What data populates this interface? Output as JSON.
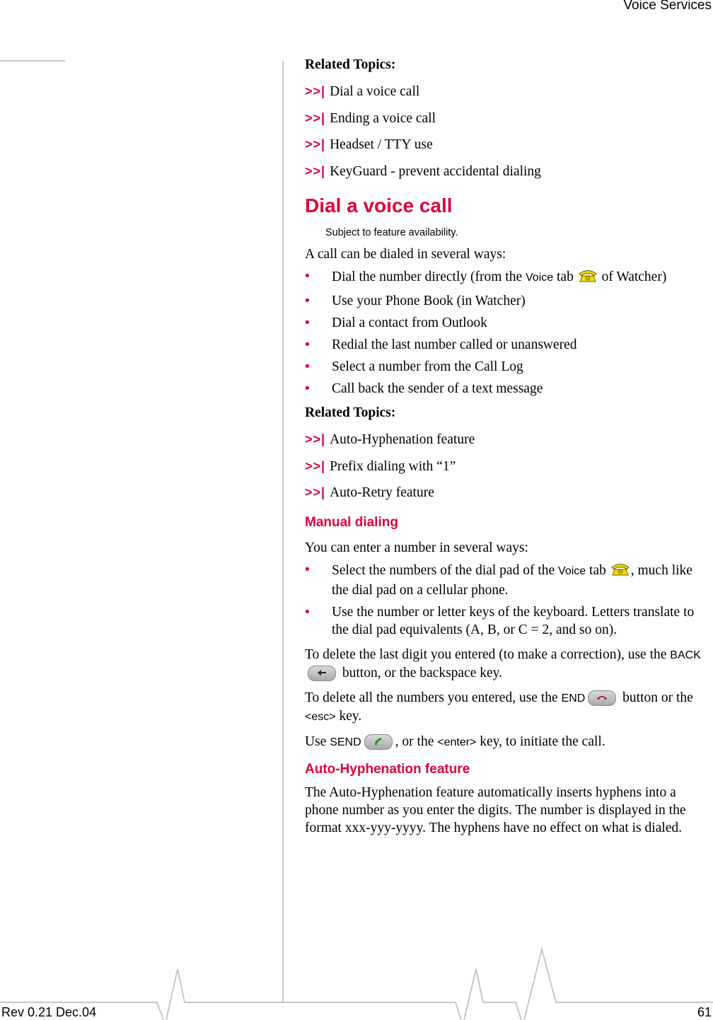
{
  "header": {
    "title": "Voice Services"
  },
  "colors": {
    "accent": "#e0003c",
    "rule": "#c8c8c8"
  },
  "related_topics_1": {
    "heading": "Related Topics:",
    "arrow": ">>|",
    "links": [
      "Dial a voice call",
      "Ending a voice call",
      "Headset / TTY use",
      "KeyGuard - prevent accidental dialing"
    ]
  },
  "dial_section": {
    "title": "Dial a voice call",
    "note": "Subject to feature availability.",
    "intro": "A call can be dialed in several ways:",
    "bullets": {
      "b1_pre": "Dial the number directly (from the ",
      "b1_ui": "Voice",
      "b1_mid": " tab ",
      "b1_icon": "phone-icon",
      "b1_post": " of Watcher)",
      "b2": "Use your Phone Book (in Watcher)",
      "b3": "Dial a contact from Outlook",
      "b4": "Redial the last number called or unanswered",
      "b5": "Select a number from the Call Log",
      "b6": "Call back the sender of a text message"
    }
  },
  "related_topics_2": {
    "heading": "Related Topics:",
    "arrow": ">>|",
    "links": [
      "Auto-Hyphenation feature",
      "Prefix dialing with “1”",
      "Auto-Retry feature"
    ]
  },
  "manual_section": {
    "title": "Manual dialing",
    "intro": "You can enter a number in several ways:",
    "bullet1_pre": "Select the numbers of the dial pad of the ",
    "bullet1_ui": "Voice",
    "bullet1_mid": " tab ",
    "bullet1_post": ", much like the dial pad on a cellular phone.",
    "bullet2": "Use the number or letter keys of the keyboard. Letters translate to the dial pad equivalents (A, B, or C = 2, and so on).",
    "back_pre": "To delete the last digit you entered (to make a correction), use the ",
    "back_ui": "BACK",
    "back_post": " button, or the backspace key.",
    "end_pre": "To delete all the numbers you entered, use the ",
    "end_ui": "END",
    "end_mid": " button or the ",
    "end_key": "<esc>",
    "end_post": " key.",
    "send_pre": "Use ",
    "send_ui": "SEND",
    "send_mid": ", or the ",
    "send_key": "<enter>",
    "send_post": " key, to initiate the call."
  },
  "hyphen_section": {
    "title": "Auto-Hyphenation feature",
    "body": "The Auto-Hyphenation feature automatically inserts hyphens into a phone number as you enter the digits. The number is displayed in the format xxx-yyy-yyyy. The hyphens have no effect on what is dialed."
  },
  "footer": {
    "revision": "Rev 0.21  Dec.04",
    "page_number": "61"
  }
}
